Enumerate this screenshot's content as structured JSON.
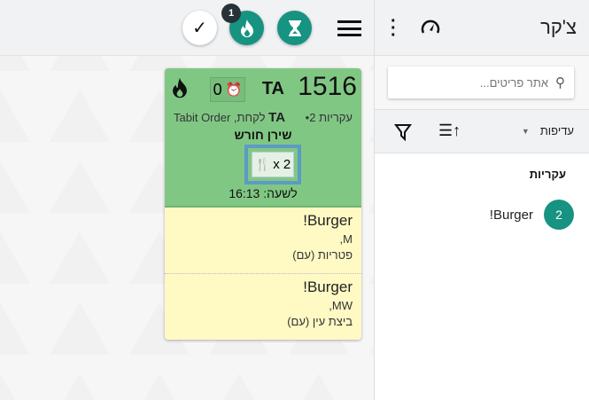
{
  "topbar": {
    "fire_badge": "1"
  },
  "order": {
    "number": "1516",
    "type": "TA",
    "timer": "0",
    "courses": "עקריות 2•",
    "order_type_bold": "TA",
    "order_source": "לקחת, Tabit Order",
    "customer": "שירן חורש",
    "diners": "x 2",
    "time": "לשעה: 16:13",
    "items": [
      {
        "name": "Burger!",
        "size": "M,",
        "mod": "פטריות (עם)"
      },
      {
        "name": "Burger!",
        "size": "MW,",
        "mod": "ביצת עין (עם)"
      }
    ]
  },
  "sidebar": {
    "title": "צ'קר",
    "search_placeholder": "אתר פריטים...",
    "sort_label": "עדיפות",
    "section": "עקריות",
    "list": [
      {
        "count": "2",
        "name": "Burger!"
      }
    ]
  },
  "colors": {
    "accent": "#179382",
    "card_green": "#81c784",
    "card_yellow": "#fff9c4"
  }
}
